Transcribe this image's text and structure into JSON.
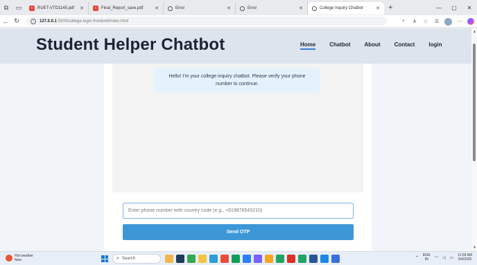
{
  "browser": {
    "tabs": [
      {
        "title": "RUET-VTD1145.pdf",
        "icon": "pdf-icon"
      },
      {
        "title": "Final_Report_save.pdf",
        "icon": "pdf-icon"
      },
      {
        "title": "Error",
        "icon": "globe-icon"
      },
      {
        "title": "Error",
        "icon": "globe-icon"
      },
      {
        "title": "College Inquiry Chatbot",
        "icon": "globe-icon"
      }
    ],
    "new_tab": "+",
    "url_host": "127.0.0.1",
    "url_path": ":5500/college-login-frontend/index.html"
  },
  "site": {
    "title": "Student Helper Chatbot",
    "nav": [
      "Home",
      "Chatbot",
      "About",
      "Contact",
      "login"
    ],
    "active_nav": "Home"
  },
  "chat": {
    "bot_message": "Hello! I'm your college inquiry chatbot. Please verify your phone number to continue.",
    "phone_placeholder": "Enter phone number with country code (e.g., +919876543210)",
    "phone_value": "",
    "send_button": "Send OTP"
  },
  "taskbar": {
    "weather_title": "Hot weather",
    "weather_sub": "Now",
    "search_label": "Search",
    "lang_line1": "ENG",
    "lang_line2": "IN",
    "time": "11:59 AM",
    "date": "5/4/2025"
  },
  "colors": {
    "accent": "#3d97d6",
    "header_bg": "#dde4ee",
    "bubble_bg": "#e5f2fc"
  }
}
